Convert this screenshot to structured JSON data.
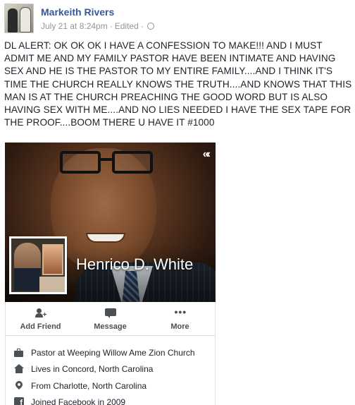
{
  "post": {
    "author_name": "Markeith Rivers",
    "timestamp": "July 21 at 8:24pm",
    "edited_label": "Edited",
    "separator": "·",
    "text": "DL ALERT: OK OK OK I HAVE A CONFESSION TO MAKE!!! AND I MUST ADMIT ME AND MY FAMILY PASTOR HAVE BEEN INTIMATE AND HAVING SEX AND HE IS THE PASTOR TO MY ENTIRE FAMILY....AND I THINK IT'S TIME THE CHURCH REALLY KNOWS THE TRUTH....AND KNOWS THAT THIS MAN IS AT THE CHURCH PREACHING THE GOOD WORD BUT IS ALSO HAVING SEX WITH ME....AND NO LIES NEEDED I HAVE THE SEX TAPE FOR THE PROOF....BOOM THERE U HAVE IT #1000"
  },
  "profile_card": {
    "name": "Henrico D. White",
    "collapse_glyph": "«‹",
    "actions": [
      {
        "label": "Add Friend",
        "icon": "add-friend-icon"
      },
      {
        "label": "Message",
        "icon": "message-icon"
      },
      {
        "label": "More",
        "icon": "more-icon",
        "glyph": "•••"
      }
    ],
    "about": [
      {
        "text": "Pastor at Weeping Willow Ame Zion Church",
        "icon": "briefcase-icon"
      },
      {
        "text": "Lives in Concord, North Carolina",
        "icon": "home-icon"
      },
      {
        "text": "From Charlotte, North Carolina",
        "icon": "location-pin-icon"
      },
      {
        "text": "Joined Facebook in 2009",
        "icon": "facebook-icon",
        "glyph": "f"
      }
    ]
  },
  "colors": {
    "author_link": "#365899",
    "meta_text": "#90949c",
    "body_text": "#1d2129",
    "icon_gray": "#4b4f56"
  }
}
